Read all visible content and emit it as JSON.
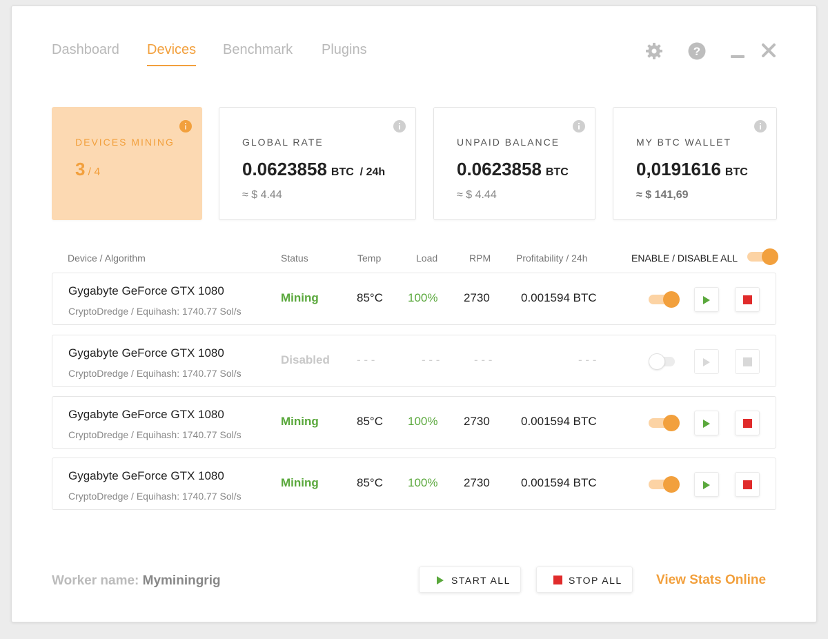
{
  "nav": {
    "tabs": [
      {
        "label": "Dashboard",
        "active": false
      },
      {
        "label": "Devices",
        "active": true
      },
      {
        "label": "Benchmark",
        "active": false
      },
      {
        "label": "Plugins",
        "active": false
      }
    ],
    "icons": [
      "gear-icon",
      "help-icon",
      "minimize-icon",
      "close-icon"
    ]
  },
  "cards": {
    "devices_mining": {
      "label": "DEVICES MINING",
      "count": "3",
      "total": "/ 4"
    },
    "global_rate": {
      "label": "GLOBAL RATE",
      "value": "0.0623858",
      "unit": "BTC  / 24h",
      "usd": "≈ $ 4.44"
    },
    "unpaid_balance": {
      "label": "UNPAID BALANCE",
      "value": "0.0623858",
      "unit": "BTC",
      "usd": "≈ $ 4.44"
    },
    "wallet": {
      "label": "MY BTC WALLET",
      "value": "0,0191616",
      "unit": "BTC",
      "usd": "≈ $ 141,69"
    }
  },
  "table": {
    "headers": {
      "device": "Device / Algorithm",
      "status": "Status",
      "temp": "Temp",
      "load": "Load",
      "rpm": "RPM",
      "profit": "Profitability / 24h",
      "enable_all": "ENABLE / DISABLE ALL"
    },
    "enable_all_on": true,
    "rows": [
      {
        "name": "Gygabyte GeForce GTX 1080",
        "algo": "CryptoDredge / Equihash: 1740.77 Sol/s",
        "status": "Mining",
        "temp": "85°C",
        "load": "100%",
        "rpm": "2730",
        "profit": "0.001594 BTC",
        "enabled": true
      },
      {
        "name": "Gygabyte GeForce GTX 1080",
        "algo": "CryptoDredge / Equihash: 1740.77 Sol/s",
        "status": "Disabled",
        "temp": "- - -",
        "load": "- - -",
        "rpm": "- - -",
        "profit": "- - -",
        "enabled": false
      },
      {
        "name": "Gygabyte GeForce GTX 1080",
        "algo": "CryptoDredge / Equihash: 1740.77 Sol/s",
        "status": "Mining",
        "temp": "85°C",
        "load": "100%",
        "rpm": "2730",
        "profit": "0.001594 BTC",
        "enabled": true
      },
      {
        "name": "Gygabyte GeForce GTX 1080",
        "algo": "CryptoDredge / Equihash: 1740.77 Sol/s",
        "status": "Mining",
        "temp": "85°C",
        "load": "100%",
        "rpm": "2730",
        "profit": "0.001594 BTC",
        "enabled": true
      }
    ]
  },
  "footer": {
    "worker_label": "Worker name:",
    "worker_name": "Myminingrig",
    "start_all": "START ALL",
    "stop_all": "STOP ALL",
    "view_stats": "View Stats Online"
  },
  "colors": {
    "accent": "#f2a03d",
    "accent_light": "#fcd9b2",
    "mining_green": "#5aa83c",
    "stop_red": "#e02b2b"
  }
}
